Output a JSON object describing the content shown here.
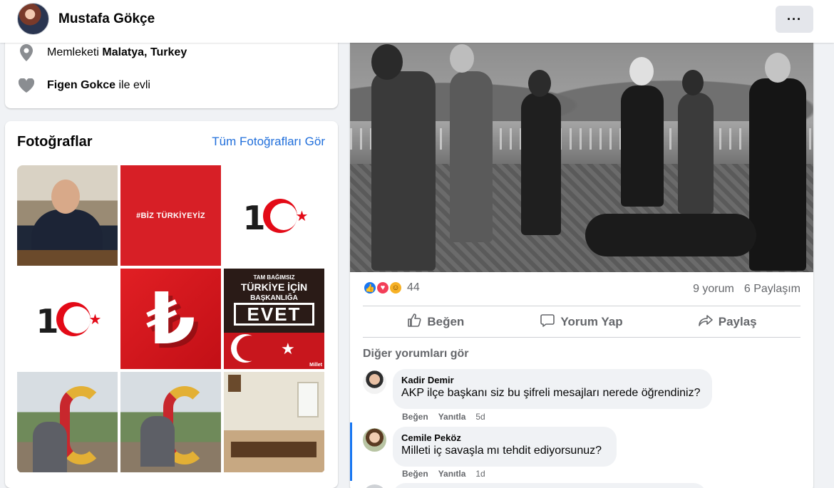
{
  "header": {
    "profile_name": "Mustafa Gökçe",
    "more_label": "···"
  },
  "intro": {
    "hometown_prefix": "Memleketi",
    "hometown_value": "Malatya, Turkey",
    "relationship_name": "Figen Gokce",
    "relationship_suffix": "ile evli"
  },
  "photos": {
    "title": "Fotoğraflar",
    "see_all": "Tüm Fotoğrafları Gör",
    "tile2_text": "#BİZ TÜRKİYEYİZ",
    "tile3_text": "15",
    "tile4_text": "15",
    "tile5_text": "₺",
    "tile6_line1": "TAM BAĞIMSIZ",
    "tile6_line2": "TÜRKİYE İÇİN",
    "tile6_line3": "BAŞKANLIĞA",
    "tile6_evet": "EVET",
    "tile6_brand": "Millet"
  },
  "post": {
    "reaction_count": "44",
    "comments_count": "9 yorum",
    "shares_count": "6 Paylaşım",
    "actions": {
      "like": "Beğen",
      "comment": "Yorum Yap",
      "share": "Paylaş"
    },
    "more_comments": "Diğer yorumları gör"
  },
  "comments": [
    {
      "name": "Kadir Demir",
      "text": "AKP ilçe başkanı siz bu şifreli mesajları nerede öğrendiniz?",
      "like": "Beğen",
      "reply": "Yanıtla",
      "time": "5d"
    },
    {
      "name": "Cemile Peköz",
      "text": "Milleti iç savaşla mı tehdit ediyorsunuz?",
      "like": "Beğen",
      "reply": "Yanıtla",
      "time": "1d"
    }
  ],
  "colors": {
    "accent": "#1877f2",
    "link": "#216fdb",
    "muted": "#65676b",
    "background": "#f0f2f5"
  },
  "icons": [
    "location-pin-icon",
    "heart-icon",
    "like-reaction-icon",
    "love-reaction-icon",
    "haha-reaction-icon",
    "thumbs-up-icon",
    "comment-icon",
    "share-icon"
  ]
}
